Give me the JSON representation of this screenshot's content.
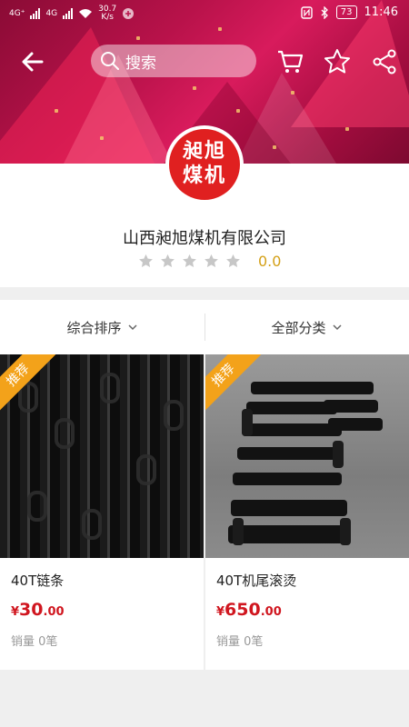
{
  "status_bar": {
    "network_left": "4G⁺",
    "network_right": "4G",
    "speed_value": "30.7",
    "speed_unit": "K/s",
    "battery": "73",
    "time": "11:46"
  },
  "topnav": {
    "search_placeholder": "搜索"
  },
  "shop": {
    "logo_text_line1": "昶旭",
    "logo_text_line2": "煤机",
    "name": "山西昶旭煤机有限公司",
    "rating_stars": 0,
    "rating_max": 5,
    "score": "0.0"
  },
  "filters": {
    "sort_label": "综合排序",
    "category_label": "全部分类"
  },
  "products": [
    {
      "badge": "推荐",
      "title": "40T链条",
      "currency": "¥",
      "price_int": "30",
      "price_dec": ".00",
      "sales": "销量 0笔"
    },
    {
      "badge": "推荐",
      "title": "40T机尾滚烫",
      "currency": "¥",
      "price_int": "650",
      "price_dec": ".00",
      "sales": "销量 0笔"
    }
  ],
  "colors": {
    "brand_red": "#e02020",
    "price_red": "#d0161f",
    "badge_orange": "#f3a21a",
    "score_gold": "#d4a017"
  }
}
